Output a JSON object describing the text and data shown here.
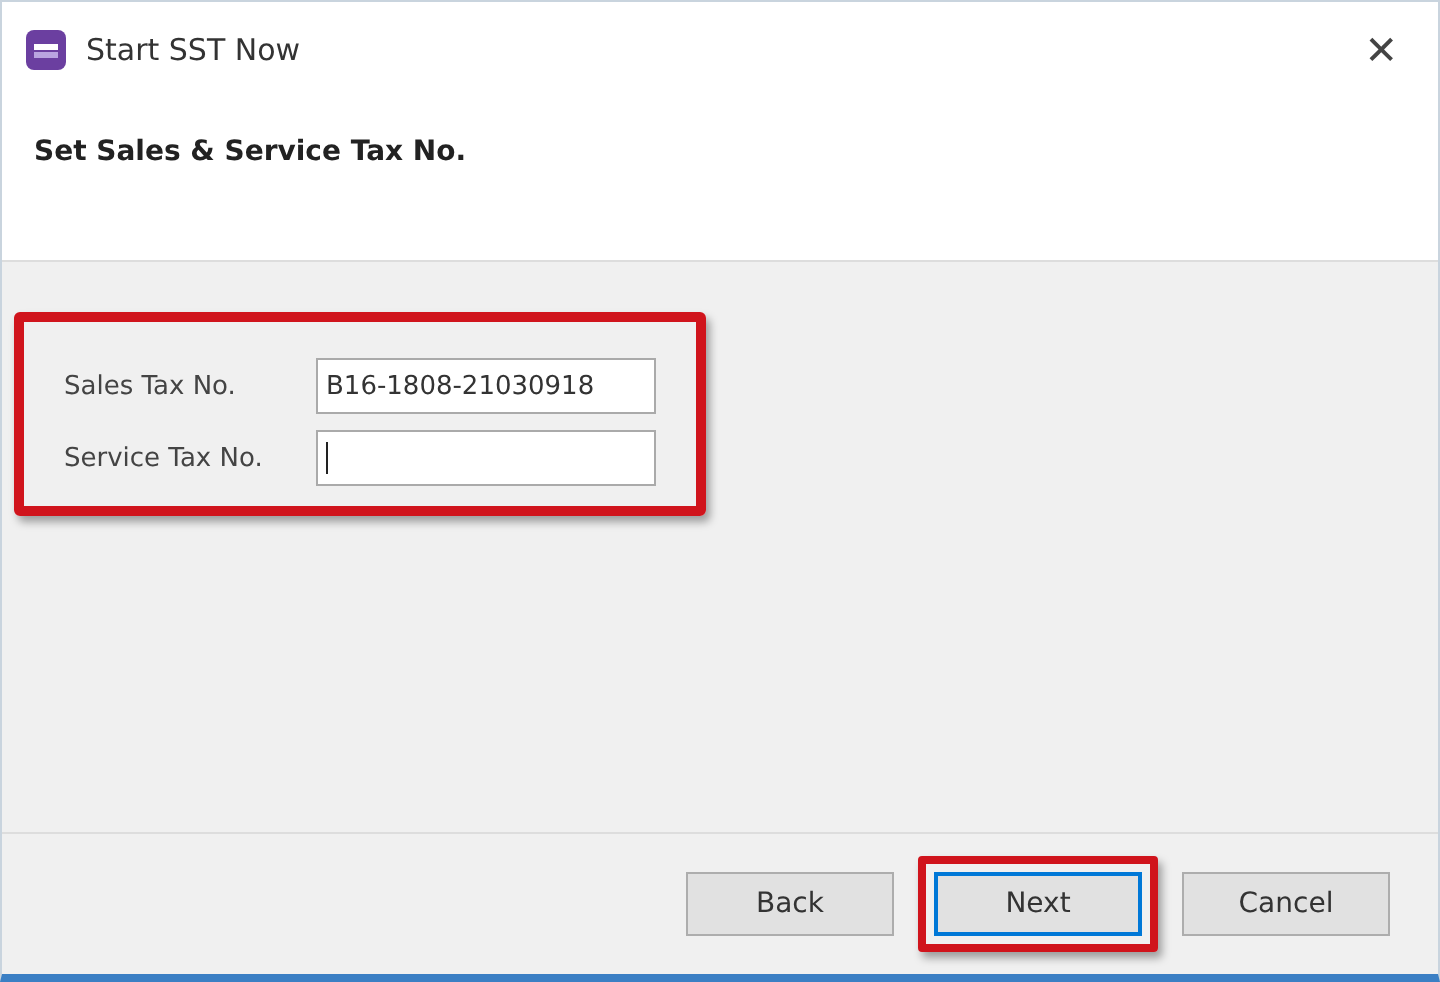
{
  "window": {
    "title": "Start SST Now",
    "close": "✕"
  },
  "header": {
    "heading": "Set Sales & Service Tax No."
  },
  "form": {
    "highlighted": true,
    "fields": [
      {
        "label": "Sales Tax No.",
        "value": "B16-1808-21030918",
        "focused": false
      },
      {
        "label": "Service Tax No.",
        "focused": true
      }
    ]
  },
  "buttons": [
    {
      "label": "Back",
      "default": false,
      "highlighted": false
    },
    {
      "label": "Next",
      "default": true,
      "highlighted": true
    },
    {
      "label": "Cancel",
      "default": false,
      "highlighted": false
    }
  ]
}
